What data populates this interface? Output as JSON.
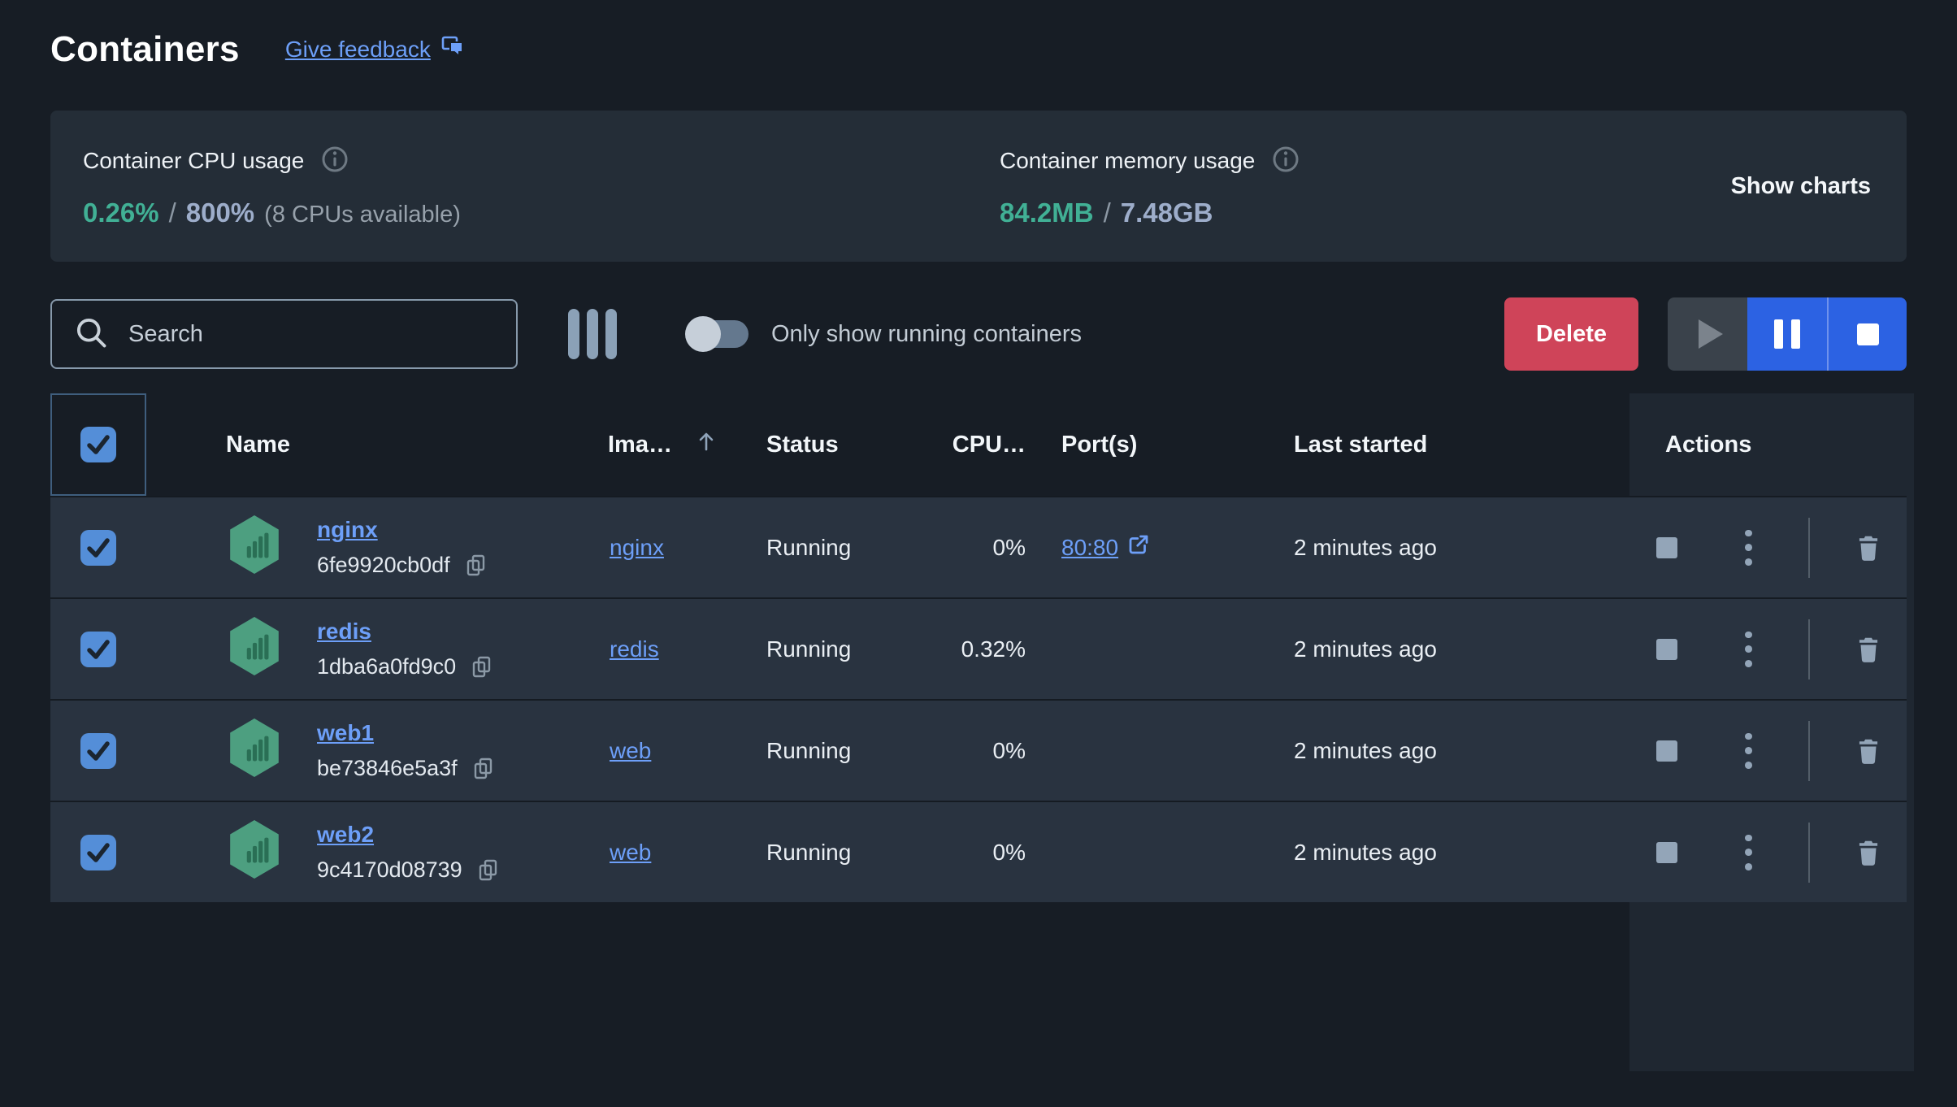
{
  "page": {
    "title": "Containers"
  },
  "header": {
    "feedback_link": "Give feedback"
  },
  "stats": {
    "cpu": {
      "label": "Container CPU usage",
      "used": "0.26%",
      "separator": "/",
      "total": "800%",
      "note": "(8 CPUs available)"
    },
    "memory": {
      "label": "Container memory usage",
      "used": "84.2MB",
      "separator": "/",
      "total": "7.48GB"
    },
    "show_charts_label": "Show charts"
  },
  "toolbar": {
    "search_placeholder": "Search",
    "toggle_label": "Only show running containers",
    "delete_label": "Delete"
  },
  "table": {
    "columns": {
      "name": "Name",
      "image": "Ima…",
      "status": "Status",
      "cpu": "CPU…",
      "ports": "Port(s)",
      "last_started": "Last started",
      "actions": "Actions"
    },
    "rows": [
      {
        "name": "nginx",
        "id": "6fe9920cb0df",
        "image": "nginx",
        "status": "Running",
        "cpu": "0%",
        "ports": "80:80",
        "last_started": "2 minutes ago"
      },
      {
        "name": "redis",
        "id": "1dba6a0fd9c0",
        "image": "redis",
        "status": "Running",
        "cpu": "0.32%",
        "ports": "",
        "last_started": "2 minutes ago"
      },
      {
        "name": "web1",
        "id": "be73846e5a3f",
        "image": "web",
        "status": "Running",
        "cpu": "0%",
        "ports": "",
        "last_started": "2 minutes ago"
      },
      {
        "name": "web2",
        "id": "9c4170d08739",
        "image": "web",
        "status": "Running",
        "cpu": "0%",
        "ports": "",
        "last_started": "2 minutes ago"
      }
    ]
  },
  "icons": {
    "feedback": "feedback-chat-icon",
    "info": "info-icon",
    "search": "search-icon",
    "columns": "columns-icon",
    "sort": "sort-up-icon",
    "container": "container-hexagon-icon",
    "copy": "copy-icon",
    "external": "external-link-icon",
    "play": "play-icon",
    "pause": "pause-icon",
    "stop": "stop-icon",
    "kebab": "more-options-icon",
    "trash": "trash-icon"
  },
  "colors": {
    "page_bg": "#171d25",
    "panel_bg": "#242d37",
    "row_bg": "#293340",
    "accent_blue": "#2c62e3",
    "link_blue": "#6d9ff8",
    "teal": "#41b095",
    "delete_red": "#cf4459",
    "checkbox_blue": "#548ed8"
  }
}
